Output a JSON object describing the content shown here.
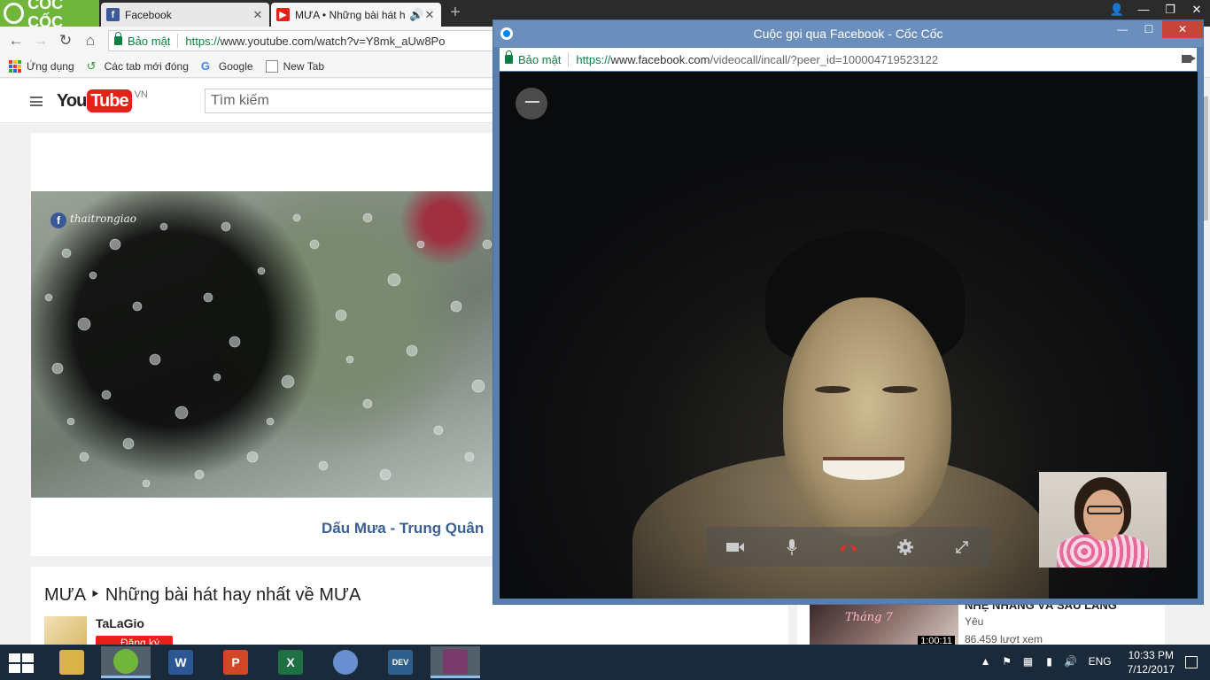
{
  "browser": {
    "brand": "CỐC CỐC",
    "tabs": [
      {
        "label": "Facebook",
        "close": "✕"
      },
      {
        "label": "MƯA • Những bài hát h",
        "close": "✕"
      }
    ],
    "new_tab": "+",
    "address": {
      "secure_label": "Bảo mật",
      "url_scheme": "https://",
      "url_host": "www.youtube.com",
      "url_path": "/watch?v=Y8mk_aUw8Po"
    },
    "bookmarks": [
      "Ứng dụng",
      "Các tab mới đóng",
      "Google",
      "New Tab"
    ]
  },
  "youtube": {
    "logo_you": "You",
    "logo_tube": "Tube",
    "country": "VN",
    "search_placeholder": "Tìm kiếm",
    "video_caption": "Dấu Mưa - Trung Quân",
    "thumb_signature": "thaitrongiao",
    "playlist_title": "MƯA ‣ Những bài hát hay nhất về MƯA",
    "channel_name": "TaLaGio",
    "subscribe_label": "Đăng ký",
    "side_video": {
      "title": "NHẸ NHÀNG VÀ SÂU LẮNG",
      "channel": "Yêu",
      "views": "86.459 lượt xem",
      "duration": "1:00:11",
      "thumb_text": "Tháng 7"
    }
  },
  "fb_call": {
    "window_title": "Cuộc gọi qua Facebook - Cốc Cốc",
    "secure_label": "Bảo mật",
    "url_scheme": "https://",
    "url_host": "www.facebook.com",
    "url_path": "/videocall/incall/?peer_id=100004719523122",
    "window_controls": [
      "—",
      "☐",
      "✕"
    ],
    "call_controls": [
      "camera-icon",
      "microphone-icon",
      "end-call-icon",
      "settings-icon",
      "fullscreen-icon"
    ]
  },
  "taskbar": {
    "apps": [
      {
        "name": "file-explorer",
        "color": "#d9b24a",
        "glyph": ""
      },
      {
        "name": "coccoc",
        "color": "#6fb63a",
        "glyph": ""
      },
      {
        "name": "word",
        "color": "#2b5797",
        "glyph": "W"
      },
      {
        "name": "powerpoint",
        "color": "#d24726",
        "glyph": "P"
      },
      {
        "name": "excel",
        "color": "#1e7145",
        "glyph": "X"
      },
      {
        "name": "paint",
        "color": "#6a8fd0",
        "glyph": ""
      },
      {
        "name": "devcpp",
        "color": "#2d5e8e",
        "glyph": "DEV"
      },
      {
        "name": "winrar",
        "color": "#7a3a6a",
        "glyph": ""
      }
    ],
    "language": "ENG",
    "time": "10:33 PM",
    "date": "7/12/2017"
  },
  "colors": {
    "coccoc_green": "#6fb63a",
    "youtube_red": "#e62117",
    "fb_blue": "#6b8fbd",
    "secure_green": "#0b8043"
  }
}
